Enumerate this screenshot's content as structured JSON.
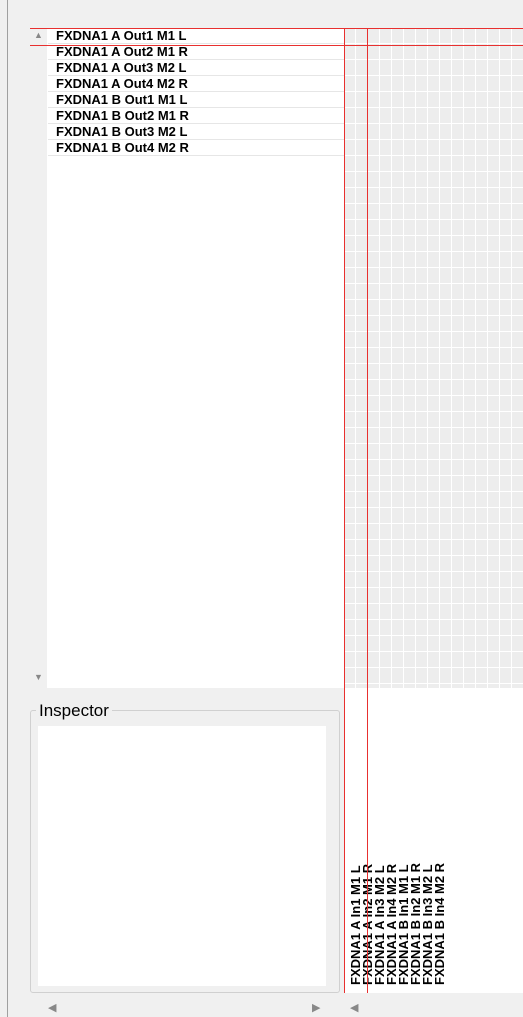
{
  "outputs": [
    "FXDNA1 A Out1 M1 L",
    "FXDNA1 A Out2 M1 R",
    "FXDNA1 A Out3 M2 L",
    "FXDNA1 A Out4 M2 R",
    "FXDNA1 B Out1 M1 L",
    "FXDNA1 B Out2 M1 R",
    "FXDNA1 B Out3 M2 L",
    "FXDNA1 B Out4 M2 R"
  ],
  "inputs": [
    "FXDNA1 A In1 M1 L",
    "FXDNA1 A In2 M1 R",
    "FXDNA1 A In3 M2 L",
    "FXDNA1 A In4 M2 R",
    "FXDNA1 B In1 M1 L",
    "FXDNA1 B In2 M1 R",
    "FXDNA1 B In3 M2 L",
    "FXDNA1 B In4 M2 R"
  ],
  "inspector": {
    "title": "Inspector"
  },
  "scroll": {
    "up_icon": "▲",
    "down_icon": "▼",
    "left_icon": "◀",
    "right_icon": "▶"
  },
  "colors": {
    "selection": "#e8302f",
    "grid_cell": "#ededed"
  }
}
